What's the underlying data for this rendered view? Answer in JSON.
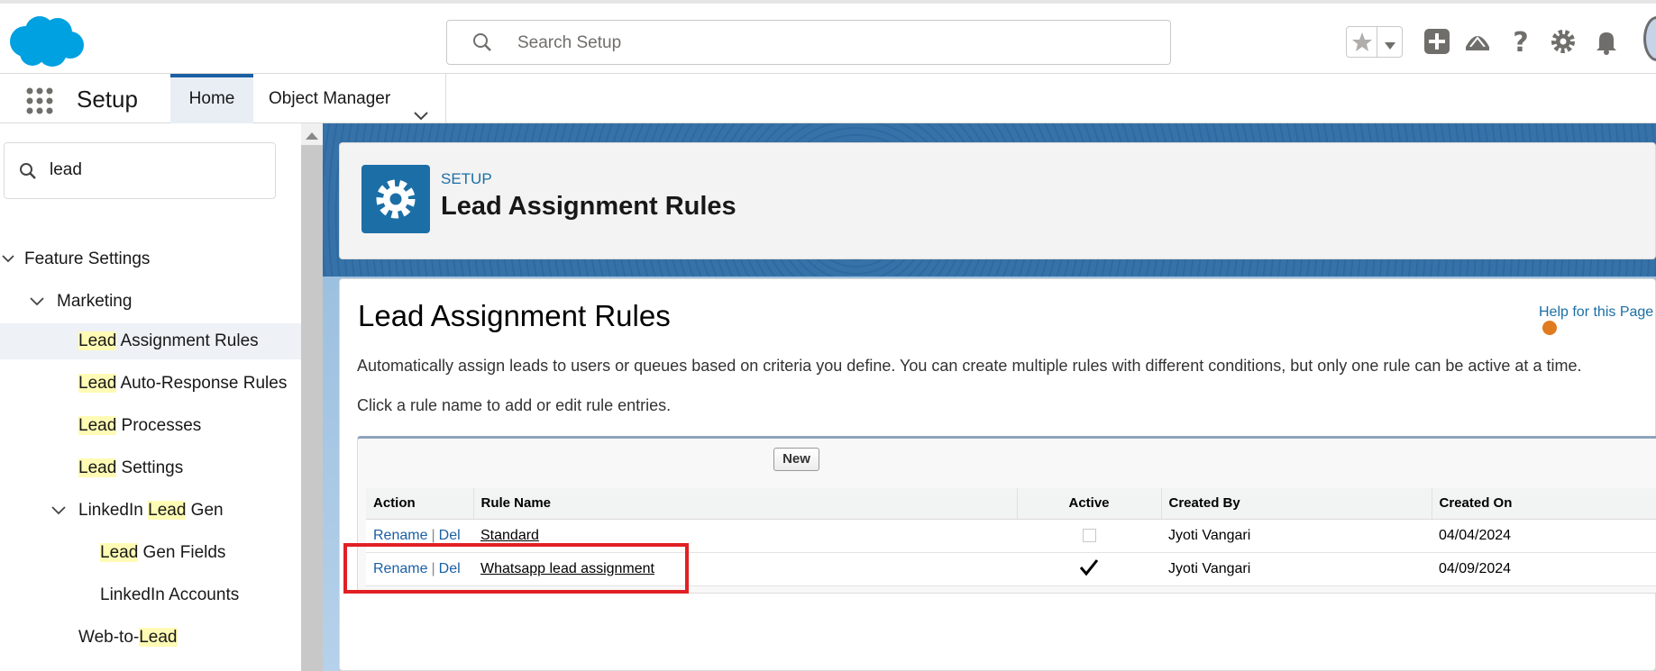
{
  "search": {
    "placeholder": "Search Setup"
  },
  "nav": {
    "app_name": "Setup",
    "tabs": [
      {
        "label": "Home"
      },
      {
        "label": "Object Manager"
      }
    ]
  },
  "sidebar": {
    "quickfind_value": "lead",
    "items": [
      {
        "pre": "",
        "hl": "",
        "post": "Feature Settings"
      },
      {
        "pre": "",
        "hl": "",
        "post": "Marketing"
      },
      {
        "pre": "",
        "hl": "Lead",
        "post": " Assignment Rules"
      },
      {
        "pre": "",
        "hl": "Lead",
        "post": " Auto-Response Rules"
      },
      {
        "pre": "",
        "hl": "Lead",
        "post": " Processes"
      },
      {
        "pre": "",
        "hl": "Lead",
        "post": " Settings"
      },
      {
        "pre": "LinkedIn ",
        "hl": "Lead",
        "post": " Gen"
      },
      {
        "pre": "",
        "hl": "Lead",
        "post": " Gen Fields"
      },
      {
        "pre": "",
        "hl": "",
        "post": "LinkedIn Accounts"
      },
      {
        "pre": "Web-to-",
        "hl": "Lead",
        "post": ""
      }
    ]
  },
  "header": {
    "eyebrow": "SETUP",
    "title": "Lead Assignment Rules"
  },
  "main": {
    "title": "Lead Assignment Rules",
    "help_link": "Help for this Page",
    "description": "Automatically assign leads to users or queues based on criteria you define. You can create multiple rules with different conditions, but only one rule can be active at a time.",
    "instruction": "Click a rule name to add or edit rule entries.",
    "new_button": "New",
    "table": {
      "headers": [
        "Action",
        "Rule Name",
        "Active",
        "Created By",
        "Created On"
      ],
      "rename_label": "Rename",
      "del_label": "Del",
      "separator": "|",
      "rows": [
        {
          "rule_name": "Standard",
          "active": false,
          "created_by": "Jyoti Vangari",
          "created_on": "04/04/2024"
        },
        {
          "rule_name": "Whatsapp lead assignment",
          "active": true,
          "created_by": "Jyoti Vangari",
          "created_on": "04/09/2024"
        }
      ]
    }
  },
  "colors": {
    "brand": "#00a1e0",
    "accent": "#1b6fa6",
    "highlight": "#fffbb5",
    "annotation": "#e12024"
  },
  "icons": [
    "salesforce-cloud-logo",
    "search-icon",
    "star-icon",
    "caret-down-icon",
    "plus-icon",
    "trailhead-icon",
    "help-icon",
    "gear-icon",
    "bell-icon",
    "avatar",
    "app-launcher-icon",
    "chevron-down-icon",
    "checkmark-icon"
  ]
}
